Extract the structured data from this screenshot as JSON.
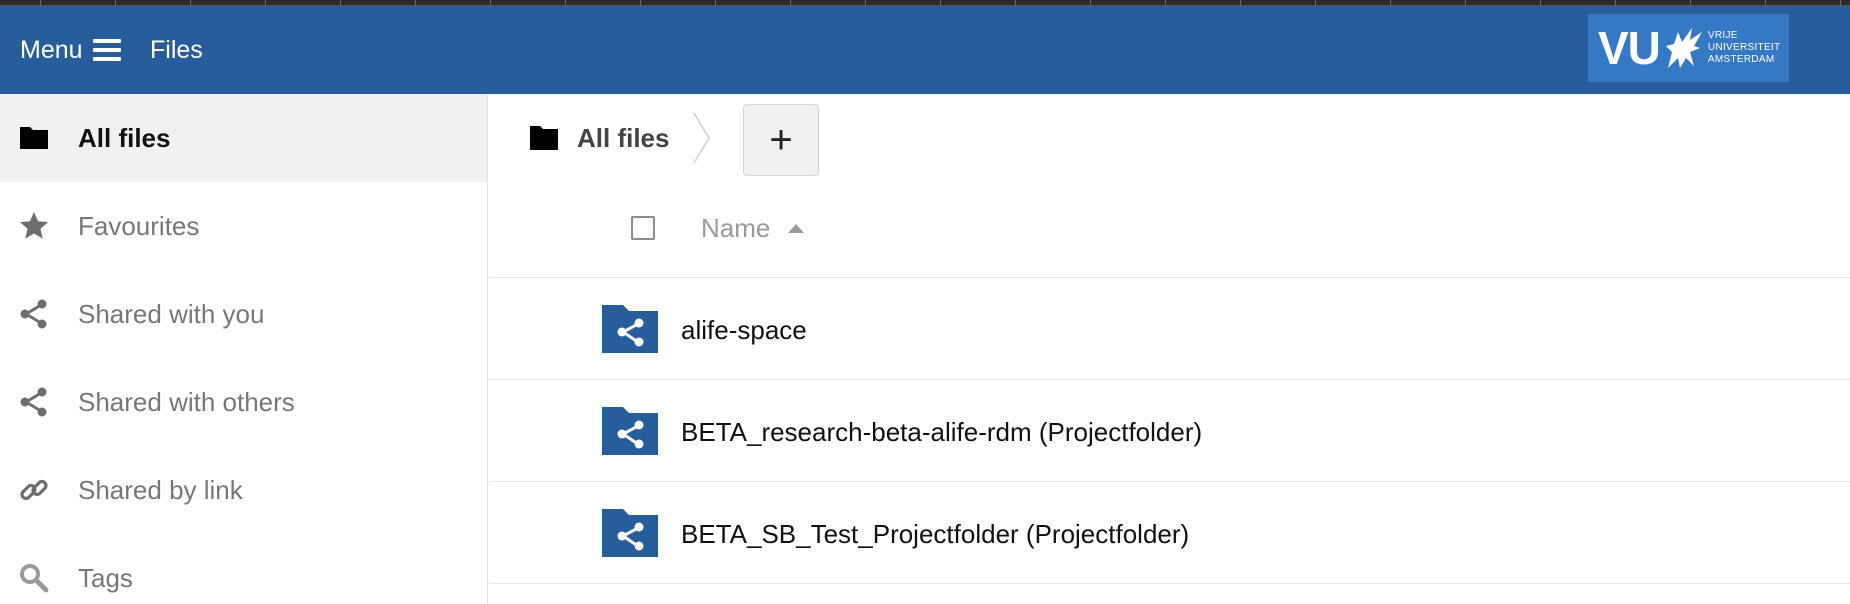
{
  "header": {
    "menu_label": "Menu",
    "app_title": "Files",
    "logo_text": "VU",
    "logo_subtext_1": "VRIJE",
    "logo_subtext_2": "UNIVERSITEIT",
    "logo_subtext_3": "AMSTERDAM",
    "background_color": "#275d9a"
  },
  "sidebar": {
    "items": [
      {
        "label": "All files",
        "icon": "folder-icon",
        "active": true
      },
      {
        "label": "Favourites",
        "icon": "star-icon",
        "active": false
      },
      {
        "label": "Shared with you",
        "icon": "share-icon",
        "active": false
      },
      {
        "label": "Shared with others",
        "icon": "share-icon",
        "active": false
      },
      {
        "label": "Shared by link",
        "icon": "link-icon",
        "active": false
      },
      {
        "label": "Tags",
        "icon": "search-icon",
        "active": false
      }
    ]
  },
  "breadcrumb": {
    "home_label": "All files",
    "new_button": "+"
  },
  "table": {
    "name_header": "Name",
    "sort": "ascending",
    "rows": [
      {
        "name": "alife-space",
        "icon": "shared-folder-icon"
      },
      {
        "name": "BETA_research-beta-alife-rdm (Projectfolder)",
        "icon": "shared-folder-icon"
      },
      {
        "name": "BETA_SB_Test_Projectfolder (Projectfolder)",
        "icon": "shared-folder-icon"
      }
    ]
  },
  "colors": {
    "accent": "#275d9a",
    "folder": "#275d9a"
  }
}
